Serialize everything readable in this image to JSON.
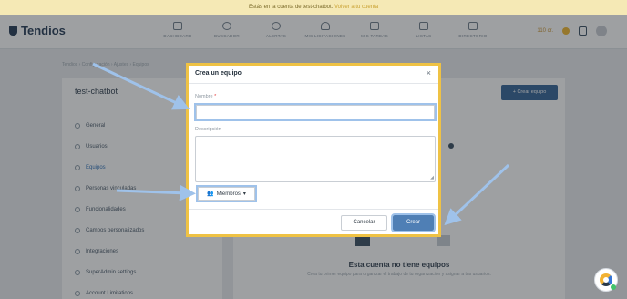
{
  "banner": {
    "text": "Estás en la cuenta de test-chatbot.",
    "link": "Volver a tu cuenta"
  },
  "app": {
    "name": "Tendios"
  },
  "nav": [
    {
      "label": "DASHBOARD",
      "icon": "bar-chart-icon"
    },
    {
      "label": "BUSCADOR",
      "icon": "search-icon"
    },
    {
      "label": "ALERTAS",
      "icon": "alarm-icon"
    },
    {
      "label": "MIS LICITACIONES",
      "icon": "heart-icon"
    },
    {
      "label": "MIS TAREAS",
      "icon": "tasks-icon"
    },
    {
      "label": "LISTAS",
      "icon": "list-icon"
    },
    {
      "label": "DIRECTORIO",
      "icon": "directory-icon"
    }
  ],
  "tools": {
    "credits": "110 cr."
  },
  "breadcrumb": "Tendios  ›  Configuración  ›  Ajustes  ›  Equipos",
  "left": {
    "title": "test-chatbot",
    "menu": [
      {
        "label": "General",
        "active": false
      },
      {
        "label": "Usuarios",
        "active": false
      },
      {
        "label": "Equipos",
        "active": true
      },
      {
        "label": "Personas vinculadas",
        "active": false
      },
      {
        "label": "Funcionalidades",
        "active": false
      },
      {
        "label": "Campos personalizados",
        "active": false
      },
      {
        "label": "Integraciones",
        "active": false
      },
      {
        "label": "SuperAdmin settings",
        "active": false
      },
      {
        "label": "Account Limitations",
        "active": false
      }
    ]
  },
  "right": {
    "create_button": "+ Crear equipo",
    "empty_title": "Esta cuenta no tiene equipos",
    "empty_subtitle": "Crea tu primer equipo para organizar el trabajo de tu organización y asignar a tus usuarios."
  },
  "modal": {
    "title": "Crea un equipo",
    "close": "×",
    "name_label": "Nombre",
    "name_required": "*",
    "name_value": "",
    "description_label": "Descripción",
    "description_value": "",
    "members_label": "Miembros",
    "members_caret": "▾",
    "cancel_label": "Cancelar",
    "create_label": "Crear"
  },
  "colors": {
    "accent": "#2f5f94",
    "highlight_border": "#efc244",
    "annotation_arrow": "#9fc2ea"
  }
}
